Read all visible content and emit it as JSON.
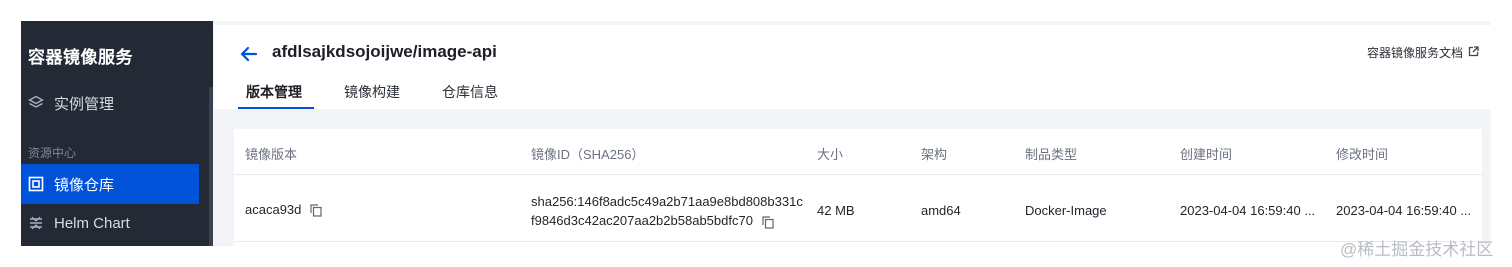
{
  "sidebar": {
    "brand": "容器镜像服务",
    "instance_label": "实例管理",
    "section_label": "资源中心",
    "image_repo_label": "镜像仓库",
    "helm_label": "Helm Chart"
  },
  "header": {
    "title": "afdlsajkdsojoijwe/image-api",
    "doc_link": "容器镜像服务文档",
    "tabs": [
      "版本管理",
      "镜像构建",
      "仓库信息"
    ]
  },
  "table": {
    "columns": [
      "镜像版本",
      "镜像ID（SHA256）",
      "大小",
      "架构",
      "制品类型",
      "创建时间",
      "修改时间"
    ],
    "rows": [
      {
        "version": "acaca93d",
        "id_line1": "sha256:146f8adc5c49a2b71aa9e8bd808b331c",
        "id_line2": "f9846d3c42ac207aa2b2b58ab5bdfc70",
        "size": "42 MB",
        "arch": "amd64",
        "type": "Docker-Image",
        "created": "2023-04-04 16:59:40 ...",
        "modified": "2023-04-04 16:59:40 ..."
      }
    ]
  },
  "watermark": "@稀土掘金技术社区",
  "colors": {
    "accent": "#0052d9",
    "sidebar_bg": "#232935"
  }
}
